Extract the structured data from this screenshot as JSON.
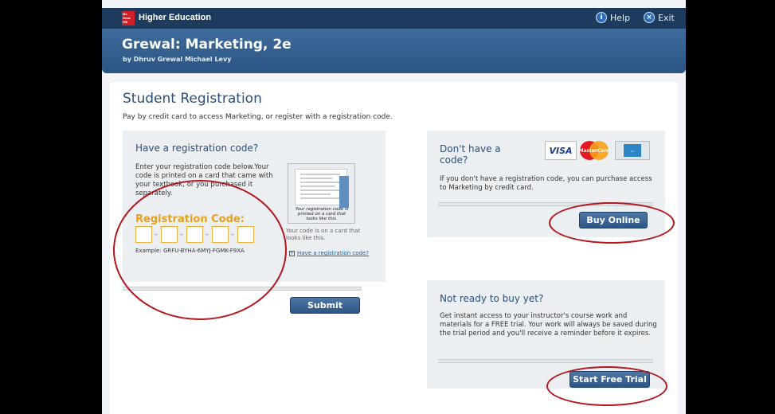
{
  "header": {
    "logo_text": "Mc Graw Hill",
    "brand": "Higher Education",
    "help_label": "Help",
    "exit_label": "Exit"
  },
  "banner": {
    "title": "Grewal: Marketing, 2e",
    "author": "by Dhruv Grewal Michael Levy"
  },
  "page": {
    "title": "Student Registration",
    "intro": "Pay by credit card to access Marketing, or register with a registration code."
  },
  "code_panel": {
    "heading": "Have a registration code?",
    "body": "Enter your registration code below.Your code is printed on a card that came with your textbook, or you purchased it separately.",
    "code_label": "Registration Code:",
    "example": "Example: GRFU-BYHA-6MYJ-FGMK-F9XA",
    "card_image_text": "Your registration code is printed on a card that looks like this.",
    "card_caption": "Your code is on a card that looks like this.",
    "help_link": "Have a registration code?",
    "submit_label": "Submit"
  },
  "buy_panel": {
    "heading": "Don't have a code?",
    "body": "If you don't have a registration code, you can purchase access to Marketing by credit card.",
    "visa_label": "VISA",
    "mastercard_label": "MasterCard",
    "buy_label": "Buy Online"
  },
  "trial_panel": {
    "heading": "Not ready to buy yet?",
    "body": "Get instant access to your instructor's course work and materials for a FREE trial. Your work will always be saved during the trial period and you'll receive a reminder before it expires.",
    "trial_label": "Start Free Trial"
  },
  "colors": {
    "header": "#1e3a5c",
    "accent": "#2c4f78",
    "code_label": "#e8a21a",
    "annotation": "#b3161b"
  }
}
